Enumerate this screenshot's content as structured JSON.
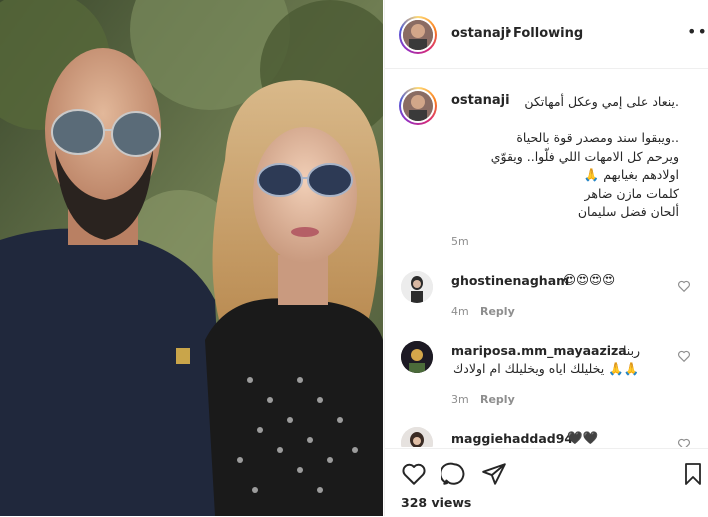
{
  "post": {
    "username": "ostanaji",
    "follow_status": "Following",
    "separator": "•",
    "more_icon": "more-options-icon",
    "caption": {
      "username": "ostanaji",
      "lines": [
        ".ينعاد على إمي وعكل أمهاتكن",
        "..ويبقوا سند ومصدر قوة بالحياة",
        "ويرحم كل الامهات اللي فلّوا.. ويقوّي",
        "اولادهم بغيابهم 🙏",
        "كلمات مازن ضاهر",
        "ألحان فضل سليمان"
      ],
      "time": "5m"
    }
  },
  "comments": [
    {
      "username": "ghostinenagham",
      "text": "😍😍😍😍",
      "time": "4m",
      "reply": "Reply"
    },
    {
      "username": "mariposa.mm_mayaaziza",
      "text": "ربنا",
      "text2": "🙏🙏 يخليلك اياه ويخليلك ام اولادك",
      "time": "3m",
      "reply": "Reply"
    },
    {
      "username": "maggiehaddad94",
      "text": "🖤🖤"
    }
  ],
  "actions": {
    "views": "328 views",
    "icons": [
      "heart-icon",
      "comment-icon",
      "share-icon",
      "bookmark-icon"
    ]
  },
  "colors": {
    "border": "#efefef",
    "muted": "#8e8e8e",
    "text": "#262626"
  }
}
